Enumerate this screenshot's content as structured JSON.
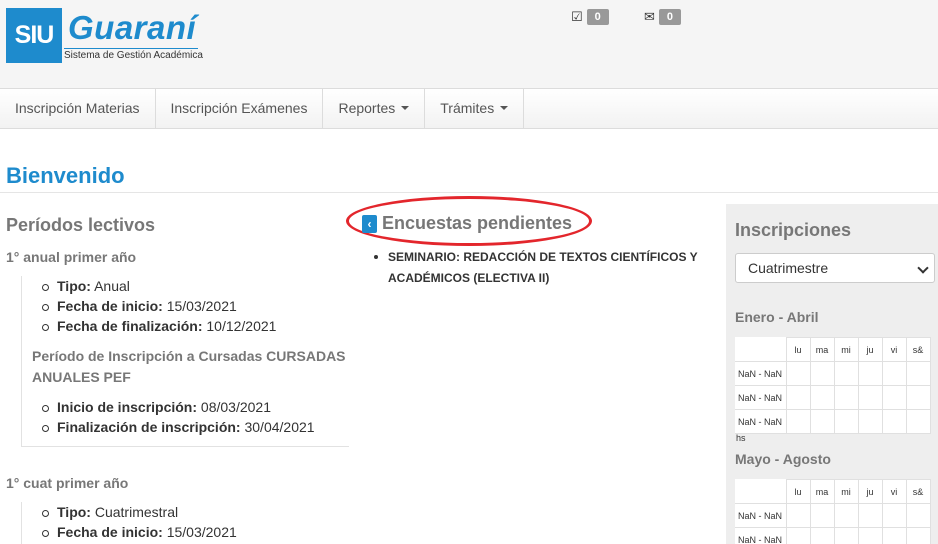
{
  "header": {
    "logo_siu": "SIU",
    "logo_name": "Guaraní",
    "logo_subtitle": "Sistema de Gestión Académica",
    "tasks_count": "0",
    "messages_count": "0"
  },
  "nav": {
    "items": [
      {
        "label": "Inscripción Materias",
        "dropdown": false
      },
      {
        "label": "Inscripción Exámenes",
        "dropdown": false
      },
      {
        "label": "Reportes",
        "dropdown": true
      },
      {
        "label": "Trámites",
        "dropdown": true
      }
    ]
  },
  "page_title": "Bienvenido",
  "periodos": {
    "title": "Períodos lectivos",
    "anual": {
      "name": "1° anual primer año",
      "tipo_label": "Tipo:",
      "tipo_value": "Anual",
      "inicio_label": "Fecha de inicio:",
      "inicio_value": "15/03/2021",
      "fin_label": "Fecha de finalización:",
      "fin_value": "10/12/2021",
      "inscripcion_title": "Período de Inscripción a Cursadas CURSADAS ANUALES PEF",
      "insc_inicio_label": "Inicio de inscripción:",
      "insc_inicio_value": "08/03/2021",
      "insc_fin_label": "Finalización de inscripción:",
      "insc_fin_value": "30/04/2021"
    },
    "cuat": {
      "name": "1° cuat primer año",
      "tipo_label": "Tipo:",
      "tipo_value": "Cuatrimestral",
      "inicio_label": "Fecha de inicio:",
      "inicio_value": "15/03/2021"
    }
  },
  "encuestas": {
    "title": "Encuestas pendientes",
    "items": [
      "SEMINARIO: REDACCIÓN DE TEXTOS CIENTÍFICOS Y ACADÉMICOS (ELECTIVA II)"
    ]
  },
  "inscripciones": {
    "title": "Inscripciones",
    "select_value": "Cuatrimestre",
    "days": [
      "lu",
      "ma",
      "mi",
      "ju",
      "vi",
      "s&"
    ],
    "month1": {
      "title": "Enero - Abril",
      "rows": [
        "NaN - NaN",
        "NaN - NaN",
        "NaN - NaN"
      ],
      "footer": "hs"
    },
    "month2": {
      "title": "Mayo - Agosto",
      "rows": [
        "NaN - NaN",
        "NaN - NaN"
      ]
    }
  },
  "colors": {
    "brand_blue": "#1e8bcd",
    "annotation_red": "#e3262c"
  }
}
